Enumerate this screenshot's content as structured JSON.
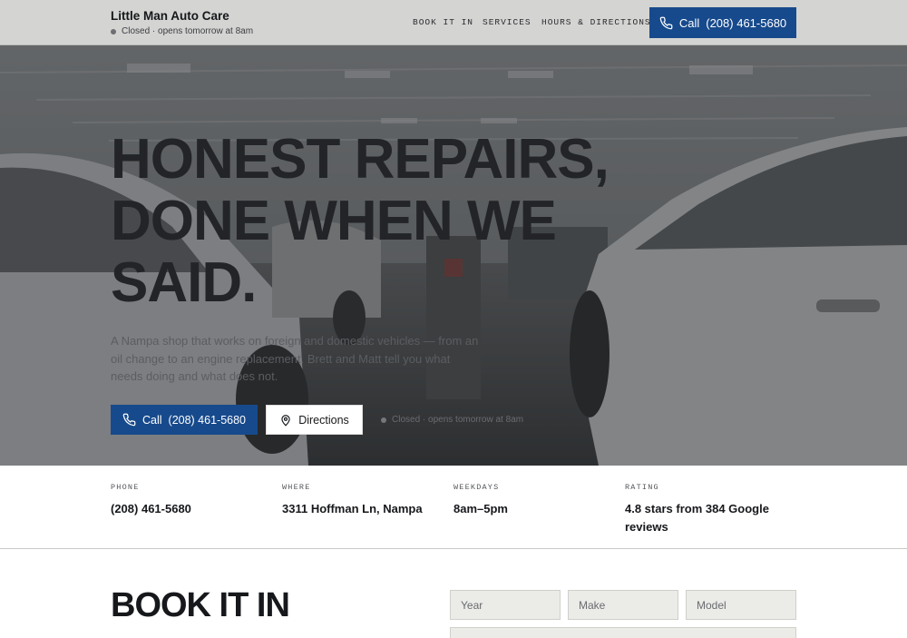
{
  "header": {
    "brand": "Little Man Auto Care",
    "status": "Closed · opens tomorrow at 8am",
    "nav": [
      "BOOK IT IN",
      "SERVICES",
      "HOURS & DIRECTIONS"
    ],
    "call_label": "Call",
    "phone": "(208) 461-5680"
  },
  "hero": {
    "kicker": "",
    "headline": [
      "HONEST REPAIRS,",
      "DONE WHEN WE",
      "SAID."
    ],
    "subtext": "A Nampa shop that works on foreign and domestic vehicles — from an oil change to an engine replacement. Brett and Matt tell you what needs doing and what does not.",
    "call_label": "Call",
    "phone": "(208) 461-5680",
    "directions_label": "Directions",
    "status": "Closed · opens tomorrow at 8am"
  },
  "info": [
    {
      "label": "PHONE",
      "value": "(208) 461-5680"
    },
    {
      "label": "WHERE",
      "value": "3311 Hoffman Ln, Nampa"
    },
    {
      "label": "WEEKDAYS",
      "value": "8am–5pm"
    },
    {
      "label": "RATING",
      "value": "4.8 stars from 384 Google reviews"
    }
  ],
  "booking": {
    "title": "BOOK IT IN",
    "fields": {
      "year": "Year",
      "make": "Make",
      "model": "Model"
    }
  },
  "icons": {
    "phone": "phone-icon",
    "pin": "map-pin-icon"
  },
  "colors": {
    "accent": "#174a8c",
    "header_bg": "#d4d4d2"
  }
}
